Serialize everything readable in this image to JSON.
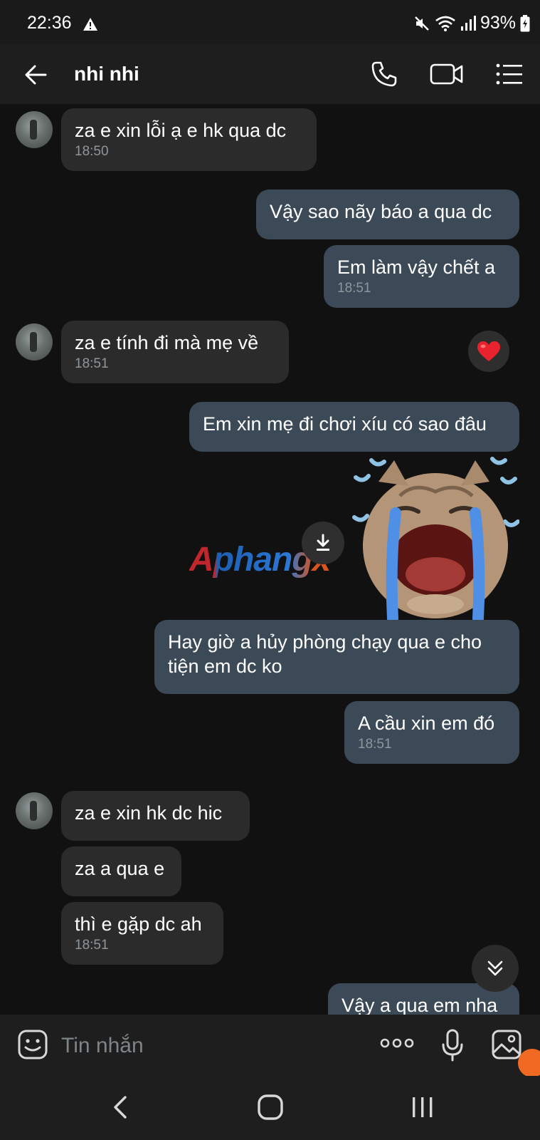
{
  "status": {
    "time": "22:36",
    "battery": "93%"
  },
  "header": {
    "contact_name": "nhi nhi"
  },
  "messages": [
    {
      "dir": "in",
      "text": "za e xin lỗi ạ e hk qua dc",
      "time": "18:50"
    },
    {
      "dir": "out",
      "text": "Vậy sao nãy báo a qua dc",
      "time": ""
    },
    {
      "dir": "out",
      "text": "Em làm vậy chết a",
      "time": "18:51"
    },
    {
      "dir": "in",
      "text": "za e tính đi mà mẹ về",
      "time": "18:51",
      "reaction": "heart"
    },
    {
      "dir": "out",
      "text": "Em xin mẹ đi chơi xíu có sao đâu",
      "time": ""
    },
    {
      "dir": "out",
      "type": "sticker",
      "sticker": "crying-cat-sticker"
    },
    {
      "dir": "out",
      "text": "Hay giờ a hủy phòng chạy qua e cho tiện em dc ko",
      "time": ""
    },
    {
      "dir": "out",
      "text": "A cầu xin em đó",
      "time": "18:51"
    },
    {
      "dir": "in",
      "text": "za e xin hk dc hic",
      "time": ""
    },
    {
      "dir": "in",
      "text": "za a qua e",
      "time": ""
    },
    {
      "dir": "in",
      "text": "thì e gặp dc ah",
      "time": "18:51"
    },
    {
      "dir": "out",
      "text": "Vậy a qua em nha",
      "time": ""
    }
  ],
  "watermark": "Aphangx",
  "composer": {
    "placeholder": "Tin nhắn"
  },
  "colors": {
    "incoming_bubble": "#2b2b2b",
    "outgoing_bubble": "#3c4a57",
    "background": "#111111"
  }
}
